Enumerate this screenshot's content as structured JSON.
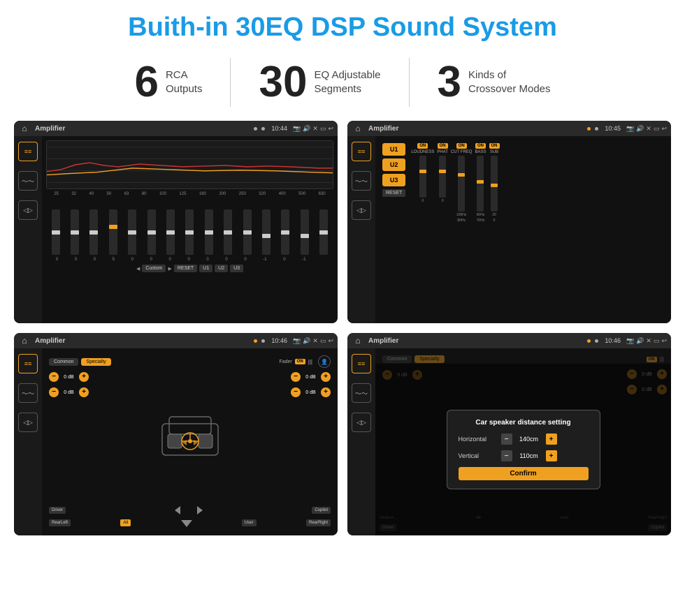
{
  "page": {
    "title": "Buith-in 30EQ DSP Sound System"
  },
  "stats": [
    {
      "number": "6",
      "line1": "RCA",
      "line2": "Outputs"
    },
    {
      "number": "30",
      "line1": "EQ Adjustable",
      "line2": "Segments"
    },
    {
      "number": "3",
      "line1": "Kinds of",
      "line2": "Crossover Modes"
    }
  ],
  "screens": [
    {
      "id": "eq-screen",
      "status_bar": {
        "title": "Amplifier",
        "time": "10:44"
      },
      "type": "eq"
    },
    {
      "id": "crossover-screen",
      "status_bar": {
        "title": "Amplifier",
        "time": "10:45"
      },
      "type": "crossover"
    },
    {
      "id": "speaker-screen",
      "status_bar": {
        "title": "Amplifier",
        "time": "10:46"
      },
      "type": "speaker"
    },
    {
      "id": "dialog-screen",
      "status_bar": {
        "title": "Amplifier",
        "time": "10:46"
      },
      "type": "dialog"
    }
  ],
  "eq": {
    "labels": [
      "25",
      "32",
      "40",
      "50",
      "63",
      "80",
      "100",
      "125",
      "160",
      "200",
      "250",
      "320",
      "400",
      "500",
      "630"
    ],
    "values": [
      "0",
      "0",
      "0",
      "5",
      "0",
      "0",
      "0",
      "0",
      "0",
      "0",
      "0",
      "-1",
      "0",
      "-1"
    ],
    "presets": [
      "Custom",
      "RESET",
      "U1",
      "U2",
      "U3"
    ]
  },
  "crossover": {
    "u_buttons": [
      "U1",
      "U2",
      "U3"
    ],
    "channels": [
      "LOUDNESS",
      "PHAT",
      "CUT FREQ",
      "BASS",
      "SUB"
    ],
    "reset_label": "RESET"
  },
  "speaker": {
    "tabs": [
      "Common",
      "Specialty"
    ],
    "fader_label": "Fader",
    "on_label": "ON",
    "db_values": [
      "0 dB",
      "0 dB",
      "0 dB",
      "0 dB"
    ],
    "bottom_btns": [
      "Driver",
      "",
      "Copilot",
      "RearLeft",
      "All",
      "User",
      "RearRight"
    ]
  },
  "dialog": {
    "title": "Car speaker distance setting",
    "horizontal_label": "Horizontal",
    "horizontal_value": "140cm",
    "vertical_label": "Vertical",
    "vertical_value": "110cm",
    "confirm_label": "Confirm",
    "tabs": [
      "Common",
      "Specialty"
    ],
    "on_label": "ON"
  }
}
